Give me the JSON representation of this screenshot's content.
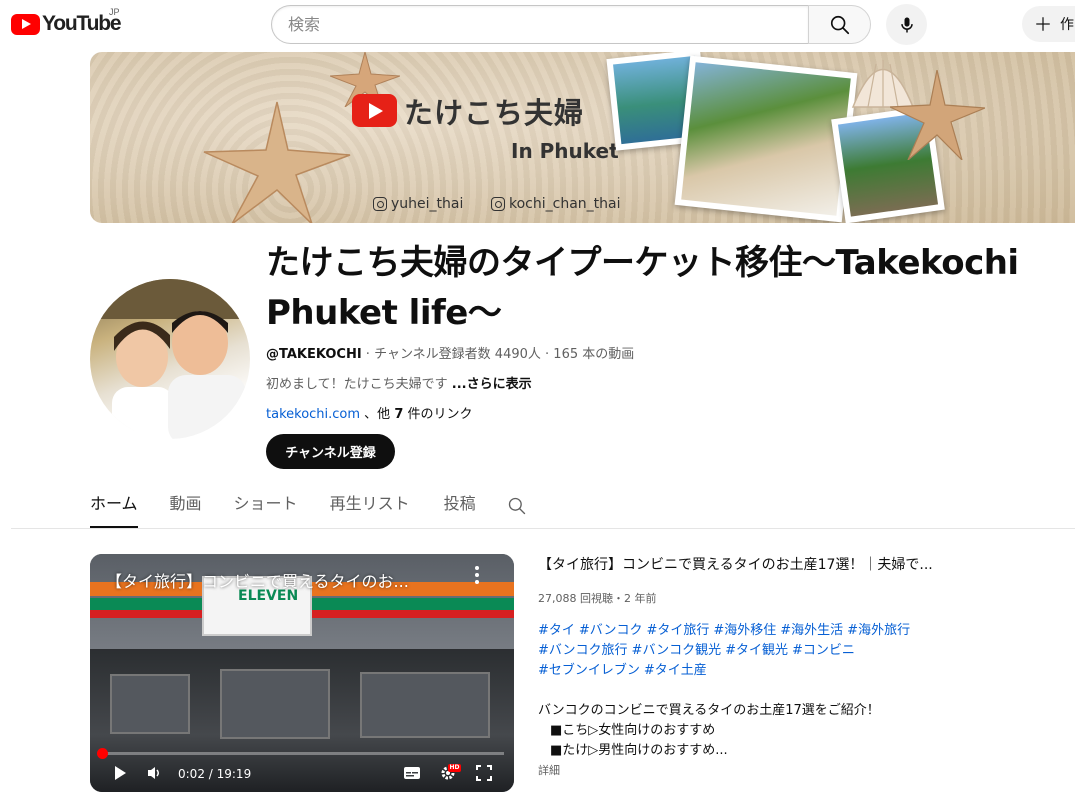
{
  "masthead": {
    "logo_text": "YouTube",
    "logo_region": "JP",
    "search_placeholder": "検索",
    "create_label": "作"
  },
  "banner": {
    "title": "たけこち夫婦",
    "subtitle": "In Phuket",
    "instagram_1": "yuhei_thai",
    "instagram_2": "kochi_chan_thai"
  },
  "channel": {
    "name": "たけこち夫婦のタイプーケット移住〜Takekochi Phuket life〜",
    "handle": "@TAKEKOCHI",
    "stats": " · チャンネル登録者数 4490人 · 165 本の動画",
    "description": "初めまして！たけこち夫婦です ",
    "description_more": "...さらに表示",
    "link_text": "takekochi.com",
    "link_suffix_prefix": " 、他 ",
    "link_count": "7",
    "link_suffix": " 件のリンク",
    "subscribe_label": "チャンネル登録"
  },
  "tabs": [
    {
      "label": "ホーム",
      "active": true
    },
    {
      "label": "動画"
    },
    {
      "label": "ショート"
    },
    {
      "label": "再生リスト"
    },
    {
      "label": "投稿"
    }
  ],
  "featured": {
    "player_title": "【タイ旅行】コンビニで買えるタイのお...",
    "sign_text": "ELEVEN",
    "time": "0:02 / 19:19",
    "progress": 0.002,
    "hd_label": "HD",
    "title": "【タイ旅行】コンビニで買えるタイのお土産17選！｜夫婦で...",
    "meta": "27,088 回視聴・2 年前",
    "tags_line1": [
      "#タイ",
      "#バンコク",
      "#タイ旅行",
      "#海外移住",
      "#海外生活",
      "#海外旅行"
    ],
    "tags_line2": [
      "#バンコク旅行",
      "#バンコク観光",
      "#タイ観光",
      "#コンビニ"
    ],
    "tags_line3": [
      "#セブンイレブン",
      "#タイ土産"
    ],
    "desc_line1": "バンコクのコンビニで買えるタイのお土産17選をご紹介！",
    "desc_line2": "■こち▷女性向けのおすすめ",
    "desc_line3": "■たけ▷男性向けのおすすめ...",
    "more_label": "詳細"
  },
  "colors": {
    "brand_red": "#ff0000",
    "link_blue": "#065fd4",
    "text_secondary": "#606060"
  }
}
